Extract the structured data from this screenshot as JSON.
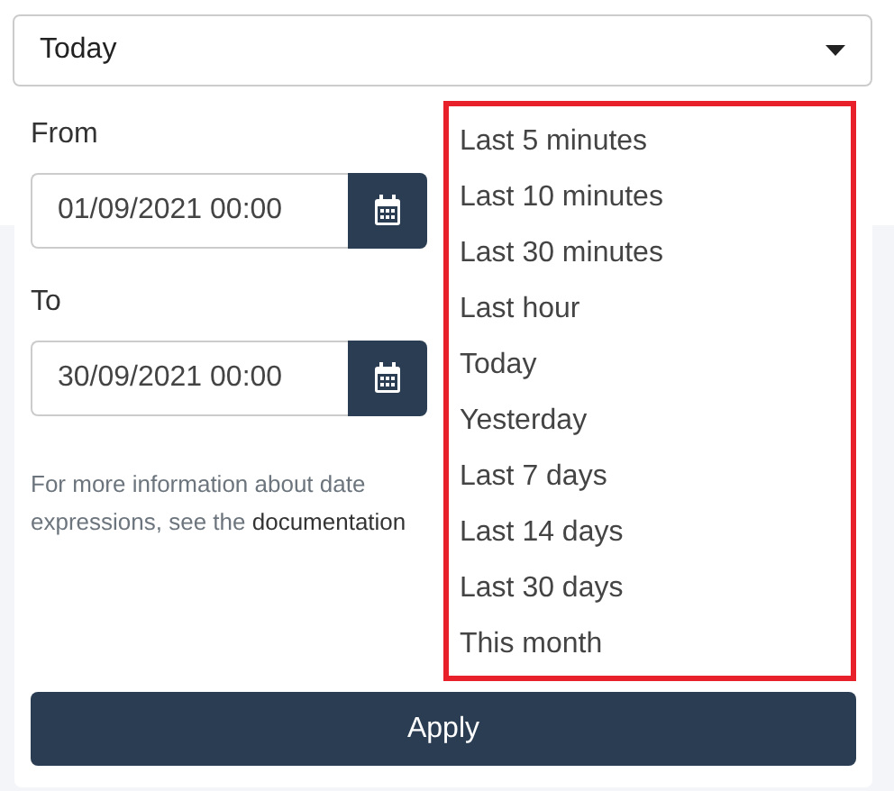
{
  "range_select": {
    "value": "Today"
  },
  "from": {
    "label": "From",
    "value": "01/09/2021 00:00"
  },
  "to": {
    "label": "To",
    "value": "30/09/2021 00:00"
  },
  "help": {
    "text": "For more information about date expressions, see the",
    "link": "documentation"
  },
  "options_highlighted": true,
  "options": [
    "Last 5 minutes",
    "Last 10 minutes",
    "Last 30 minutes",
    "Last hour",
    "Today",
    "Yesterday",
    "Last 7 days",
    "Last 14 days",
    "Last 30 days",
    "This month"
  ],
  "apply_button": "Apply"
}
